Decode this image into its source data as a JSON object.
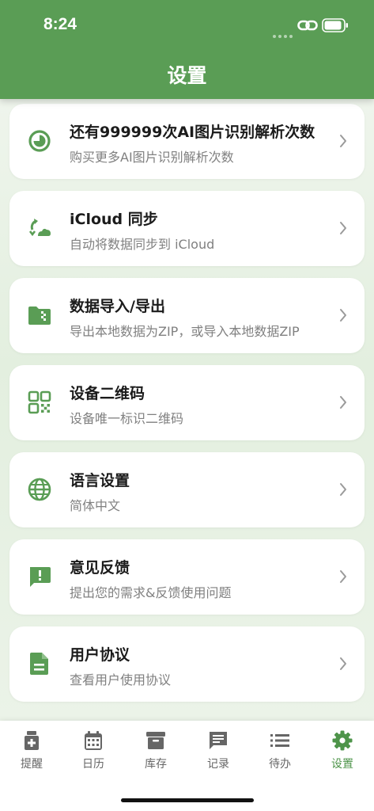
{
  "status_bar": {
    "time": "8:24"
  },
  "header": {
    "title": "设置"
  },
  "settings": [
    {
      "icon": "pie-chart-icon",
      "title": "还有999999次AI图片识别解析次数",
      "subtitle": "购买更多AI图片识别解析次数"
    },
    {
      "icon": "cloud-sync-icon",
      "title": "iCloud 同步",
      "subtitle": "自动将数据同步到 iCloud"
    },
    {
      "icon": "folder-zip-icon",
      "title": "数据导入/导出",
      "subtitle": "导出本地数据为ZIP，或导入本地数据ZIP"
    },
    {
      "icon": "qr-code-icon",
      "title": "设备二维码",
      "subtitle": "设备唯一标识二维码"
    },
    {
      "icon": "globe-icon",
      "title": "语言设置",
      "subtitle": "简体中文"
    },
    {
      "icon": "feedback-icon",
      "title": "意见反馈",
      "subtitle": "提出您的需求&反馈使用问题"
    },
    {
      "icon": "document-icon",
      "title": "用户协议",
      "subtitle": "查看用户使用协议"
    }
  ],
  "tabbar": {
    "active": "设置",
    "tabs": [
      {
        "label": "提醒",
        "icon": "medicine-bottle-icon"
      },
      {
        "label": "日历",
        "icon": "calendar-icon"
      },
      {
        "label": "库存",
        "icon": "archive-box-icon"
      },
      {
        "label": "记录",
        "icon": "message-icon"
      },
      {
        "label": "待办",
        "icon": "list-icon"
      },
      {
        "label": "设置",
        "icon": "gear-icon"
      }
    ]
  },
  "colors": {
    "primary": "#5a9d55",
    "active_tab": "#4e944a"
  }
}
